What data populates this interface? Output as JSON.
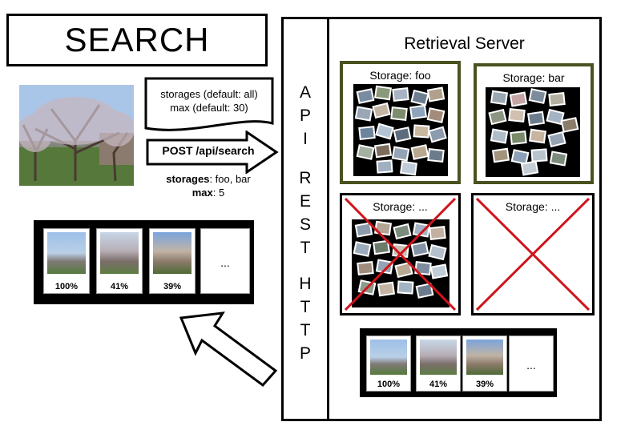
{
  "search": {
    "title": "SEARCH"
  },
  "request": {
    "note_line1": "storages (default: all)",
    "note_line2": "max (default: 30)",
    "method_label": "POST /api/search",
    "storages_key": "storages",
    "storages_value": ": foo, bar",
    "max_key": "max",
    "max_value": ": 5"
  },
  "api": {
    "letters": [
      "A",
      "P",
      "I",
      "R",
      "E",
      "S",
      "T",
      "H",
      "T",
      "T",
      "P"
    ]
  },
  "server": {
    "title": "Retrieval Server",
    "storages": [
      {
        "label": "Storage: foo",
        "selected": true,
        "has_images": true
      },
      {
        "label": "Storage: bar",
        "selected": true,
        "has_images": true
      },
      {
        "label": "Storage: ...",
        "selected": false,
        "has_images": true
      },
      {
        "label": "Storage: ...",
        "selected": false,
        "has_images": false
      }
    ]
  },
  "results_left": {
    "scores": [
      "100%",
      "41%",
      "39%"
    ],
    "more": "..."
  },
  "results_right": {
    "scores": [
      "100%",
      "41%",
      "39%"
    ],
    "more": "..."
  },
  "colors": {
    "selected_border": "#4a5220",
    "cross": "#d0141c"
  }
}
